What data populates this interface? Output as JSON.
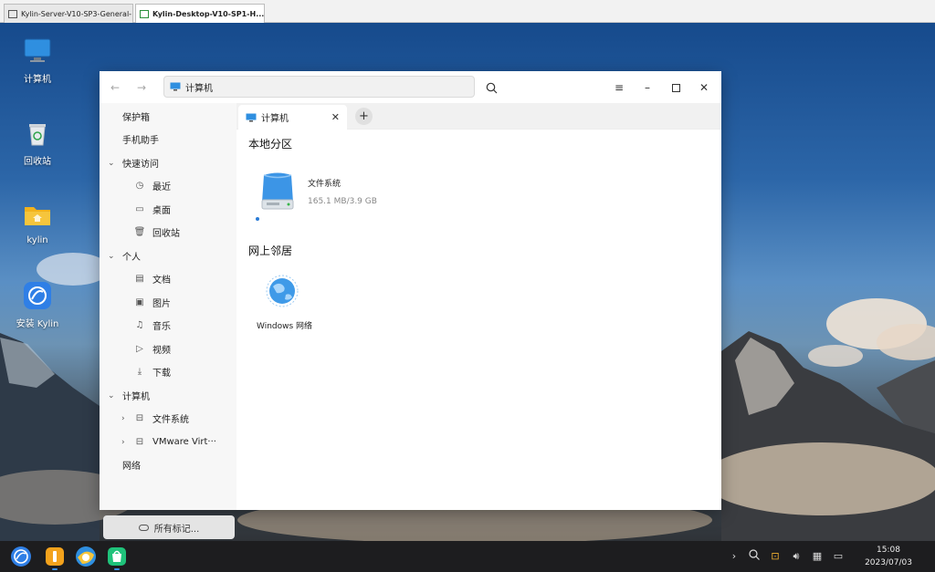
{
  "vm_tabs": [
    {
      "label": "Kylin-Server-V10-SP3-General-...",
      "active": false
    },
    {
      "label": "Kylin-Desktop-V10-SP1-H...",
      "active": true
    }
  ],
  "desktop": {
    "icons": [
      {
        "label": "计算机",
        "icon": "computer-icon"
      },
      {
        "label": "回收站",
        "icon": "trash-icon"
      },
      {
        "label": "kylin",
        "icon": "home-folder-icon"
      },
      {
        "label": "安装 Kylin",
        "icon": "install-kylin-icon"
      }
    ]
  },
  "window": {
    "address": "计算机",
    "sidebar": {
      "items": [
        {
          "label": "保护箱"
        },
        {
          "label": "手机助手"
        },
        {
          "label": "快速访问",
          "expanded": true
        },
        {
          "label": "最近",
          "icon": "clock-icon"
        },
        {
          "label": "桌面",
          "icon": "desktop-icon"
        },
        {
          "label": "回收站",
          "icon": "trash-icon"
        },
        {
          "label": "个人",
          "expanded": true
        },
        {
          "label": "文档",
          "icon": "document-icon"
        },
        {
          "label": "图片",
          "icon": "picture-icon"
        },
        {
          "label": "音乐",
          "icon": "music-icon"
        },
        {
          "label": "视频",
          "icon": "video-icon"
        },
        {
          "label": "下载",
          "icon": "download-icon"
        },
        {
          "label": "计算机",
          "expanded": true
        },
        {
          "label": "文件系统",
          "icon": "drive-icon",
          "expanded": false
        },
        {
          "label": "VMware Virt···",
          "icon": "drive-icon",
          "expanded": false
        },
        {
          "label": "网络"
        }
      ],
      "all_tags": "所有标记..."
    },
    "tab": {
      "label": "计算机"
    },
    "sections": {
      "local": "本地分区",
      "network": "网上邻居"
    },
    "drive": {
      "name": "文件系统",
      "size": "165.1 MB/3.9 GB"
    },
    "network_item": {
      "name": "Windows 网络"
    }
  },
  "taskbar": {
    "time": "15:08",
    "date": "2023/07/03"
  }
}
